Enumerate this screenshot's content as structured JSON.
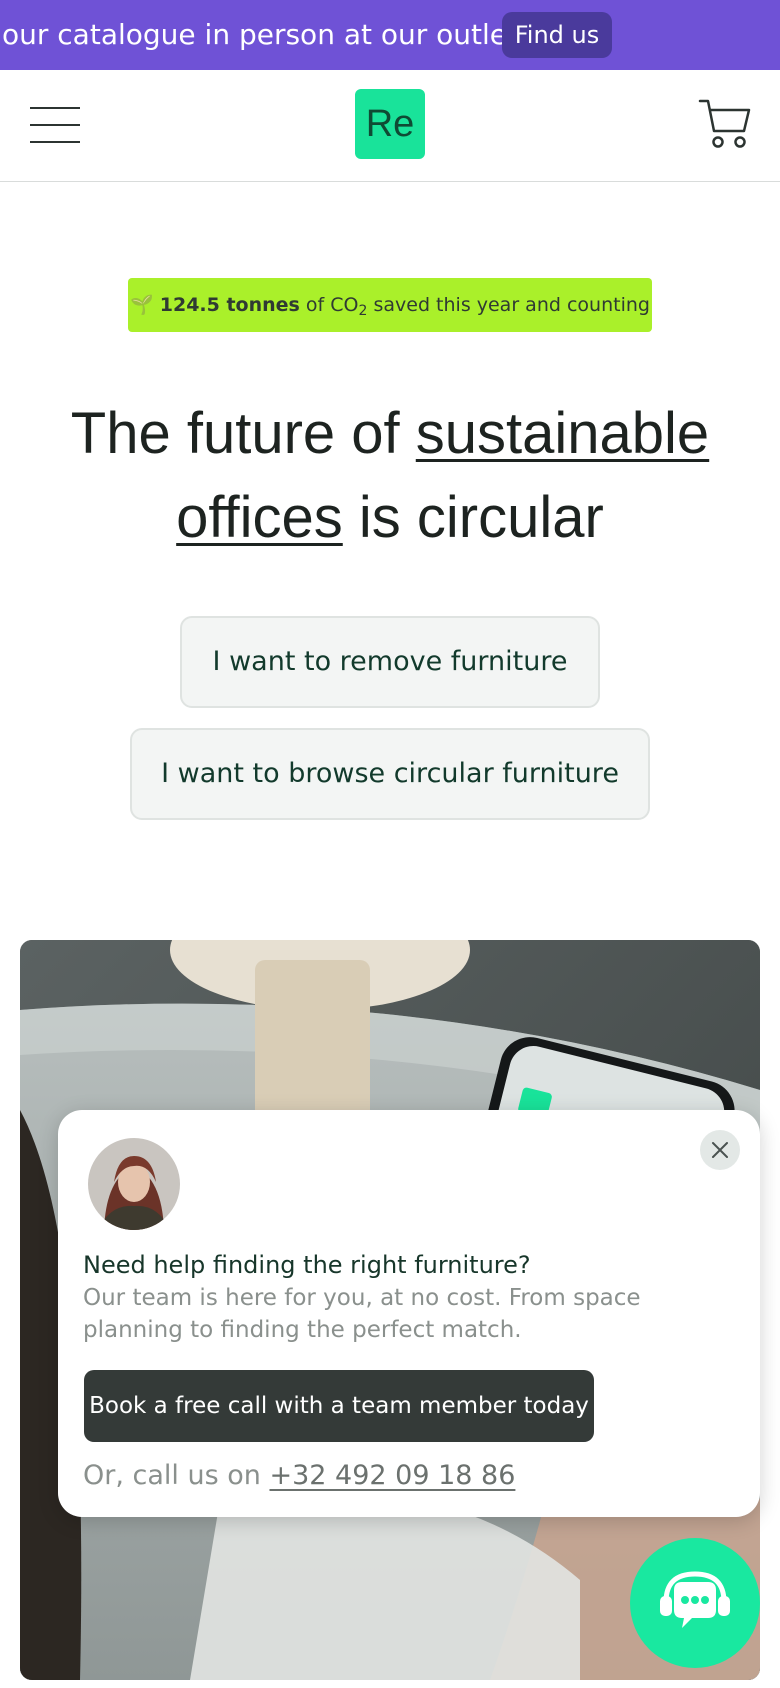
{
  "announcement": {
    "text": "our catalogue in person at our outlet!",
    "button_label": "Find us"
  },
  "header": {
    "logo_text": "Re",
    "menu_icon": "hamburger-menu-icon",
    "cart_icon": "shopping-cart-icon"
  },
  "co2_badge": {
    "icon": "seedling-icon",
    "emoji": "🌱",
    "amount": "124.5 tonnes",
    "text_before_sub": "of CO",
    "subscript": "2",
    "text_after": "saved this year and counting"
  },
  "hero": {
    "title_part1": "The future of",
    "title_underline": "sustainable offices",
    "title_part2": "is circular",
    "cta_remove": "I want to remove furniture",
    "cta_browse": "I want to browse circular furniture"
  },
  "help_popup": {
    "title": "Need help finding the right furniture?",
    "description": "Our team is here for you, at no cost. From space planning to finding the perfect match.",
    "book_button": "Book a free call with a team member today",
    "call_prefix": "Or, call us on",
    "phone": "+32 492 09 18 86",
    "close_icon": "close-icon"
  },
  "chat_widget": {
    "icon": "chat-support-icon"
  },
  "colors": {
    "announcement_bg": "#6f52d6",
    "brand_green": "#19e39a",
    "co2_badge_bg": "#aaf02a",
    "dark_button": "#343a38"
  }
}
